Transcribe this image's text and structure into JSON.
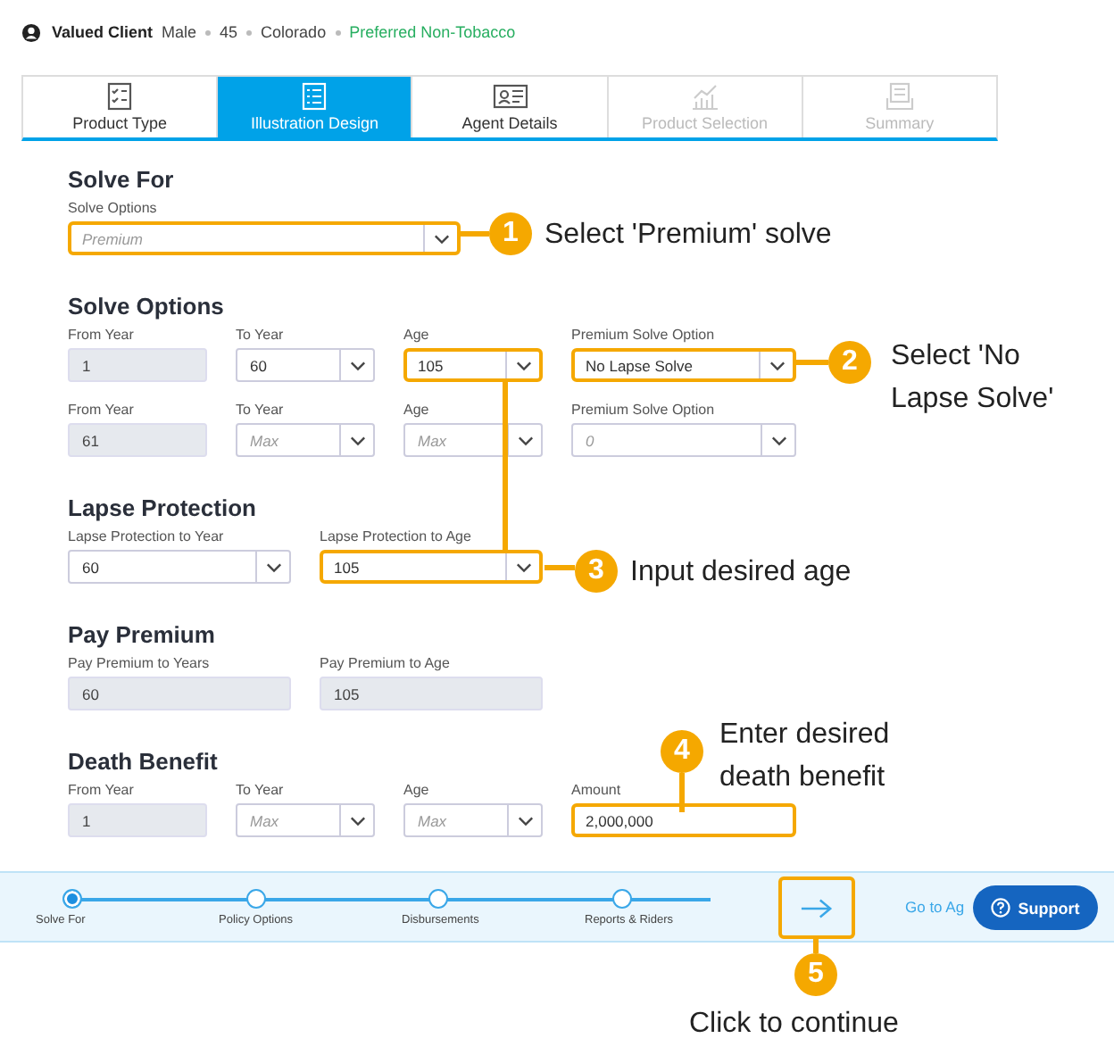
{
  "client": {
    "name": "Valued Client",
    "details": [
      "Male",
      "45",
      "Colorado"
    ],
    "status": "Preferred Non-Tobacco"
  },
  "tabs": [
    {
      "label": "Product Type",
      "selected": false,
      "disabled": false
    },
    {
      "label": "Illustration Design",
      "selected": true,
      "disabled": false
    },
    {
      "label": "Agent Details",
      "selected": false,
      "disabled": false
    },
    {
      "label": "Product Selection",
      "selected": false,
      "disabled": true
    },
    {
      "label": "Summary",
      "selected": false,
      "disabled": true
    }
  ],
  "sections": [
    {
      "title": "Solve For",
      "rows": [
        [
          {
            "label": "Solve Options",
            "kind": "select",
            "placeholder": "Premium",
            "highlighted": true
          }
        ]
      ]
    },
    {
      "title": "Solve Options",
      "rows": [
        [
          {
            "label": "From Year",
            "kind": "readonly",
            "value": "1",
            "highlighted": false
          },
          {
            "label": "To Year",
            "kind": "select",
            "value": "60",
            "highlighted": false
          },
          {
            "label": "Age",
            "kind": "select",
            "value": "105",
            "highlighted": true
          },
          {
            "label": "Premium Solve Option",
            "kind": "select",
            "value": "No Lapse Solve",
            "highlighted": true
          }
        ],
        [
          {
            "label": "From Year",
            "kind": "readonly",
            "value": "61",
            "highlighted": false
          },
          {
            "label": "To Year",
            "kind": "select",
            "placeholder": "Max",
            "highlighted": false
          },
          {
            "label": "Age",
            "kind": "select",
            "placeholder": "Max",
            "highlighted": false
          },
          {
            "label": "Premium Solve Option",
            "kind": "select",
            "placeholder": "0",
            "highlighted": false
          }
        ]
      ]
    },
    {
      "title": "Lapse Protection",
      "rows": [
        [
          {
            "label": "Lapse Protection to Year",
            "kind": "select",
            "value": "60",
            "highlighted": false
          },
          {
            "label": "Lapse Protection to Age",
            "kind": "select",
            "value": "105",
            "highlighted": true
          }
        ]
      ]
    },
    {
      "title": "Pay Premium",
      "rows": [
        [
          {
            "label": "Pay Premium to Years",
            "kind": "readonly",
            "value": "60",
            "highlighted": false
          },
          {
            "label": "Pay Premium to Age",
            "kind": "readonly",
            "value": "105",
            "highlighted": false
          }
        ]
      ]
    },
    {
      "title": "Death Benefit",
      "rows": [
        [
          {
            "label": "From Year",
            "kind": "readonly",
            "value": "1",
            "highlighted": false
          },
          {
            "label": "To Year",
            "kind": "select",
            "placeholder": "Max",
            "highlighted": false
          },
          {
            "label": "Age",
            "kind": "select",
            "placeholder": "Max",
            "highlighted": false
          },
          {
            "label": "Amount",
            "kind": "text",
            "value": "2,000,000",
            "highlighted": true
          }
        ]
      ]
    }
  ],
  "steps": [
    {
      "label": "Solve For",
      "selected": true
    },
    {
      "label": "Policy Options",
      "selected": false
    },
    {
      "label": "Disbursements",
      "selected": false
    },
    {
      "label": "Reports & Riders",
      "selected": false
    }
  ],
  "next_button": {
    "highlighted": true
  },
  "link": "Go to Ag",
  "support_button": "Support",
  "callouts": [
    {
      "number": "1",
      "lines": [
        "Select 'Premium' solve"
      ]
    },
    {
      "number": "2",
      "lines": [
        "Select 'No",
        "Lapse Solve'"
      ]
    },
    {
      "number": "3",
      "lines": [
        "Input desired age"
      ]
    },
    {
      "number": "4",
      "lines": [
        "Enter desired",
        "death benefit"
      ]
    },
    {
      "number": "5",
      "lines": [
        "Click to continue"
      ]
    }
  ]
}
